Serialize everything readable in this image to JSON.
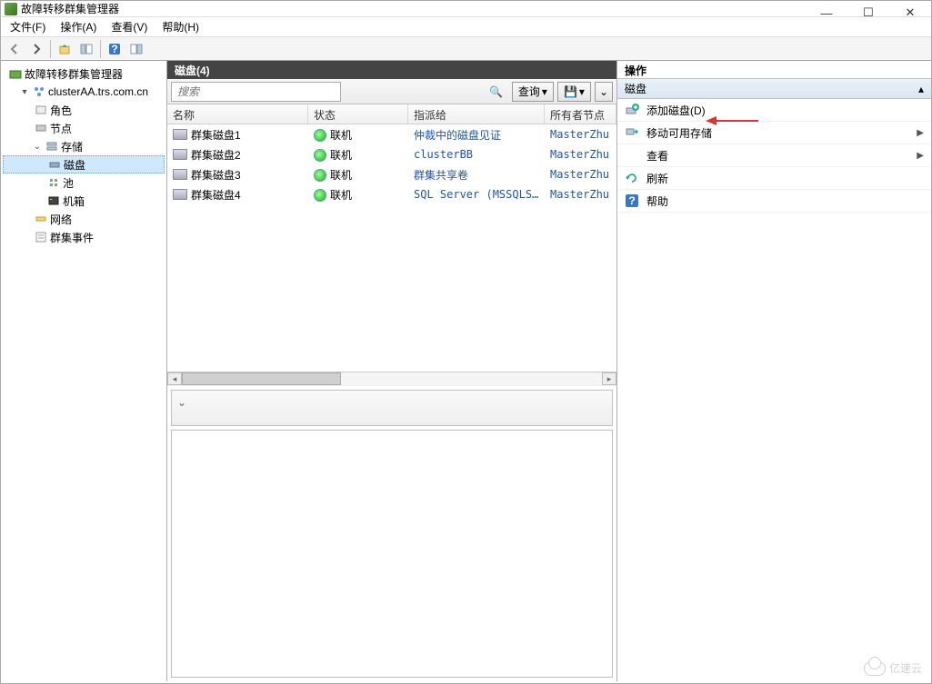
{
  "window": {
    "title": "故障转移群集管理器"
  },
  "menu": {
    "file": "文件(F)",
    "action": "操作(A)",
    "view": "查看(V)",
    "help": "帮助(H)"
  },
  "nav": {
    "root": "故障转移群集管理器",
    "cluster": "clusterAA.trs.com.cn",
    "roles": "角色",
    "nodes": "节点",
    "storage": "存储",
    "disks": "磁盘",
    "pools": "池",
    "enclosures": "机箱",
    "networks": "网络",
    "events": "群集事件"
  },
  "center": {
    "title": "磁盘(4)",
    "search_placeholder": "搜索",
    "query_btn": "查询",
    "columns": {
      "name": "名称",
      "status": "状态",
      "assign": "指派给",
      "owner": "所有者节点"
    },
    "rows": [
      {
        "name": "群集磁盘1",
        "status": "联机",
        "assign": "仲裁中的磁盘见证",
        "owner": "MasterZhu"
      },
      {
        "name": "群集磁盘2",
        "status": "联机",
        "assign": "clusterBB",
        "owner": "MasterZhu"
      },
      {
        "name": "群集磁盘3",
        "status": "联机",
        "assign": "群集共享卷",
        "owner": "MasterZhu"
      },
      {
        "name": "群集磁盘4",
        "status": "联机",
        "assign": "SQL Server (MSSQLSERV…",
        "owner": "MasterZhu"
      }
    ]
  },
  "actions": {
    "header": "操作",
    "sub": "磁盘",
    "items": [
      {
        "label": "添加磁盘(D)",
        "icon": "add-disk",
        "sub": false
      },
      {
        "label": "移动可用存储",
        "icon": "move-storage",
        "sub": true
      },
      {
        "label": "查看",
        "icon": "",
        "sub": true
      },
      {
        "label": "刷新",
        "icon": "refresh",
        "sub": false
      },
      {
        "label": "帮助",
        "icon": "help",
        "sub": false
      }
    ]
  },
  "watermark": "亿速云"
}
